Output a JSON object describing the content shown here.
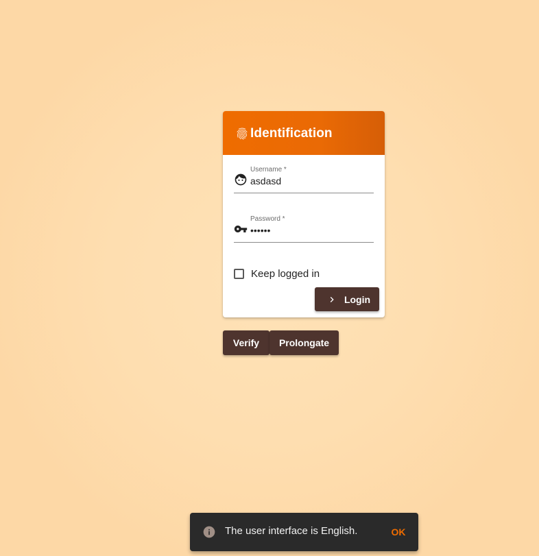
{
  "card": {
    "title": "Identification",
    "header_icon": "fingerprint-icon",
    "username": {
      "label": "Username *",
      "value": "asdasd",
      "icon": "face-icon"
    },
    "password": {
      "label": "Password *",
      "value": "••••••",
      "icon": "key-icon"
    },
    "keep_logged_in": {
      "label": "Keep logged in",
      "checked": false
    },
    "login_label": "Login"
  },
  "actions": {
    "verify_label": "Verify",
    "prolongate_label": "Prolongate"
  },
  "snackbar": {
    "message": "The user interface is English.",
    "ok_label": "OK",
    "icon": "info-icon"
  },
  "colors": {
    "accent": "#ef6c00",
    "button": "#4e342e",
    "background": "#fee2b7",
    "snackbar": "#2a2a2a"
  }
}
